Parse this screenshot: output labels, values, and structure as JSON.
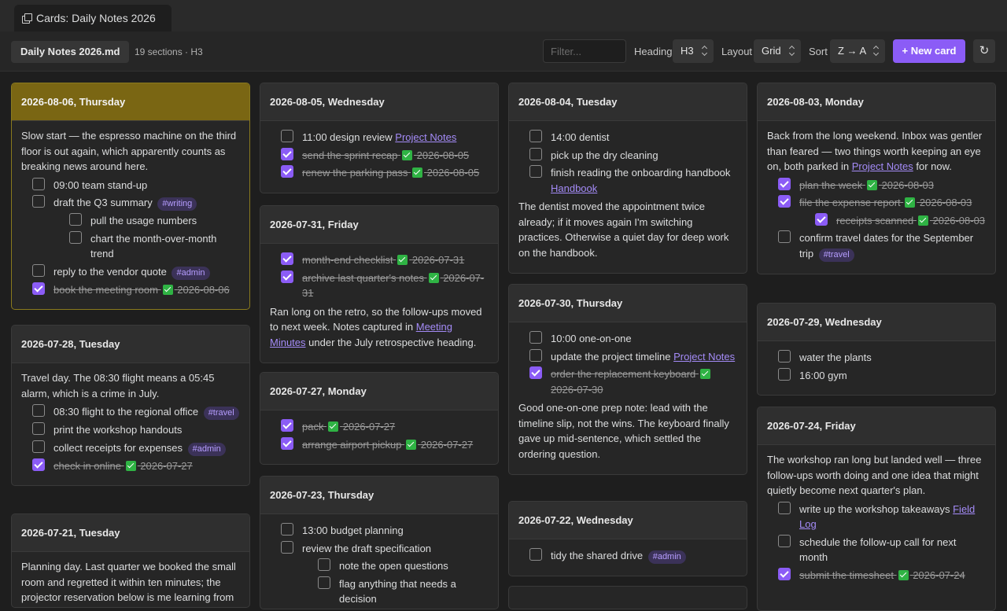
{
  "tab": {
    "title": "Cards: Daily Notes 2026",
    "icon": "cards-icon"
  },
  "toolbar": {
    "file": "Daily Notes 2026.md",
    "meta": "19 sections · H3",
    "filter_placeholder": "Filter...",
    "heading_label": "Heading",
    "heading_value": "H3",
    "layout_label": "Layout",
    "layout_value": "Grid",
    "sort_label": "Sort",
    "sort_value": "Z → A",
    "new_card": "+ New card",
    "refresh": "↻"
  },
  "colors": {
    "accent": "#8b5cf6",
    "active_header": "#7a6613",
    "check": "#2fb344",
    "tag_bg": "#3b3258",
    "link": "#a48bf7"
  },
  "cards": {
    "c0806": {
      "title": "2026-08-06, Thursday",
      "p1": "Slow start — the espresso machine on the third floor is out again, which apparently counts as breaking news around here.",
      "t1": "09:00 team stand-up",
      "t2": "draft the Q3 summary",
      "t2_tag": "#writing",
      "t3": "pull the usage numbers",
      "t4": "chart the month-over-month trend",
      "t5": "reply to the vendor quote",
      "t5_tag": "#admin",
      "t6": "book the meeting room",
      "t6_date": "2026-08-06"
    },
    "c0728": {
      "title": "2026-07-28, Tuesday",
      "p1": "Travel day. The 08:30 flight means a 05:45 alarm, which is a crime in July.",
      "t1": "08:30 flight to the regional office",
      "t1_tag": "#travel",
      "t2": "print the workshop handouts",
      "t3": "collect receipts for expenses",
      "t3_tag": "#admin",
      "t4": "check in online",
      "t4_date": "2026-07-27"
    },
    "c0721": {
      "title": "2026-07-21, Tuesday",
      "p1": "Planning day. Last quarter we booked the small room and regretted it within ten minutes; the projector reservation below is me learning from"
    },
    "c0805": {
      "title": "2026-08-05, Wednesday",
      "t1": "11:00 design review",
      "t1_link": "Project Notes",
      "t2": "send the sprint recap",
      "t2_date": "2026-08-05",
      "t3": "renew the parking pass",
      "t3_date": "2026-08-05"
    },
    "c0731": {
      "title": "2026-07-31, Friday",
      "t1": "month-end checklist",
      "t1_date": "2026-07-31",
      "t2": "archive last quarter's notes",
      "t2_date": "2026-07-31",
      "p1a": "Ran long on the retro, so the follow-ups moved to next week. Notes captured in",
      "p1_link": "Meeting Minutes",
      "p1b": "under the July retrospective heading."
    },
    "c0727": {
      "title": "2026-07-27, Monday",
      "t1": "pack",
      "t1_date": "2026-07-27",
      "t2": "arrange airport pickup",
      "t2_date": "2026-07-27"
    },
    "c0723": {
      "title": "2026-07-23, Thursday",
      "t1": "13:00 budget planning",
      "t2": "review the draft specification",
      "t3": "note the open questions",
      "t4": "flag anything that needs a decision"
    },
    "c0804": {
      "title": "2026-08-04, Tuesday",
      "t1": "14:00 dentist",
      "t2": "pick up the dry cleaning",
      "t3": "finish reading the onboarding handbook",
      "t3_link": "Handbook",
      "p1": "The dentist moved the appointment twice already; if it moves again I'm switching practices. Otherwise a quiet day for deep work on the handbook."
    },
    "c0730": {
      "title": "2026-07-30, Thursday",
      "t1": "10:00 one-on-one",
      "t2": "update the project timeline",
      "t2_link": "Project Notes",
      "t3": "order the replacement keyboard",
      "t3_date": "2026-07-30",
      "p1": "Good one-on-one prep note: lead with the timeline slip, not the wins. The keyboard finally gave up mid-sentence, which settled the ordering question."
    },
    "c0722": {
      "title": "2026-07-22, Wednesday",
      "t1": "tidy the shared drive",
      "t1_tag": "#admin"
    },
    "c0803": {
      "title": "2026-08-03, Monday",
      "p1a": "Back from the long weekend. Inbox was gentler than feared — two things worth keeping an eye on, both parked in",
      "p1_link": "Project Notes",
      "p1b": "for now.",
      "t1": "plan the week",
      "t1_date": "2026-08-03",
      "t2": "file the expense report",
      "t2_date": "2026-08-03",
      "t3": "receipts scanned",
      "t3_date": "2026-08-03",
      "t4": "confirm travel dates for the September trip",
      "t4_tag": "#travel"
    },
    "c0729": {
      "title": "2026-07-29, Wednesday",
      "t1": "water the plants",
      "t2": "16:00 gym"
    },
    "c0724": {
      "title": "2026-07-24, Friday",
      "p1": "The workshop ran long but landed well — three follow-ups worth doing and one idea that might quietly become next quarter's plan.",
      "t1": "write up the workshop takeaways",
      "t1_link": "Field Log",
      "t2": "schedule the follow-up call for next month",
      "t3": "submit the timesheet",
      "t3_date": "2026-07-24"
    }
  }
}
